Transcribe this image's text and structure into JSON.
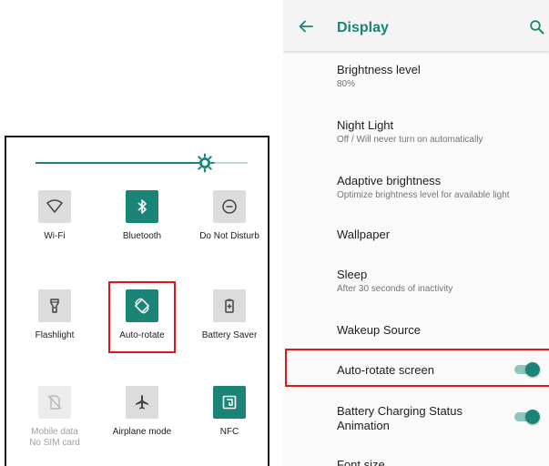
{
  "quick_settings": {
    "brightness_level": 0.8,
    "tiles": [
      {
        "label": "Wi-Fi",
        "icon": "wifi-icon",
        "state": "off"
      },
      {
        "label": "Bluetooth",
        "icon": "bluetooth-icon",
        "state": "on"
      },
      {
        "label": "Do Not Disturb",
        "icon": "do-not-disturb-icon",
        "state": "off"
      },
      {
        "label": "Flashlight",
        "icon": "flashlight-icon",
        "state": "off"
      },
      {
        "label": "Auto-rotate",
        "icon": "auto-rotate-icon",
        "state": "on"
      },
      {
        "label": "Battery Saver",
        "icon": "battery-saver-icon",
        "state": "off"
      },
      {
        "label": "Mobile data",
        "sublabel": "No SIM card",
        "icon": "mobile-data-icon",
        "state": "disabled"
      },
      {
        "label": "Airplane mode",
        "icon": "airplane-icon",
        "state": "off"
      },
      {
        "label": "NFC",
        "icon": "nfc-icon",
        "state": "on"
      }
    ]
  },
  "settings": {
    "title": "Display",
    "back_icon": "back-arrow-icon",
    "search_icon": "search-icon",
    "items": [
      {
        "title": "Brightness level",
        "subtitle": "80%"
      },
      {
        "title": "Night Light",
        "subtitle": "Off / Will never turn on automatically"
      },
      {
        "title": "Adaptive brightness",
        "subtitle": "Optimize brightness level for available light"
      },
      {
        "title": "Wallpaper"
      },
      {
        "title": "Sleep",
        "subtitle": "After 30 seconds of inactivity"
      },
      {
        "title": "Wakeup Source"
      },
      {
        "title": "Auto-rotate screen",
        "toggle": true
      },
      {
        "title": "Battery Charging Status Animation",
        "toggle": true
      },
      {
        "title": "Font size"
      }
    ]
  },
  "colors": {
    "accent": "#1a8577",
    "tile_off": "#dcdcdc",
    "highlight": "#e0161a"
  }
}
